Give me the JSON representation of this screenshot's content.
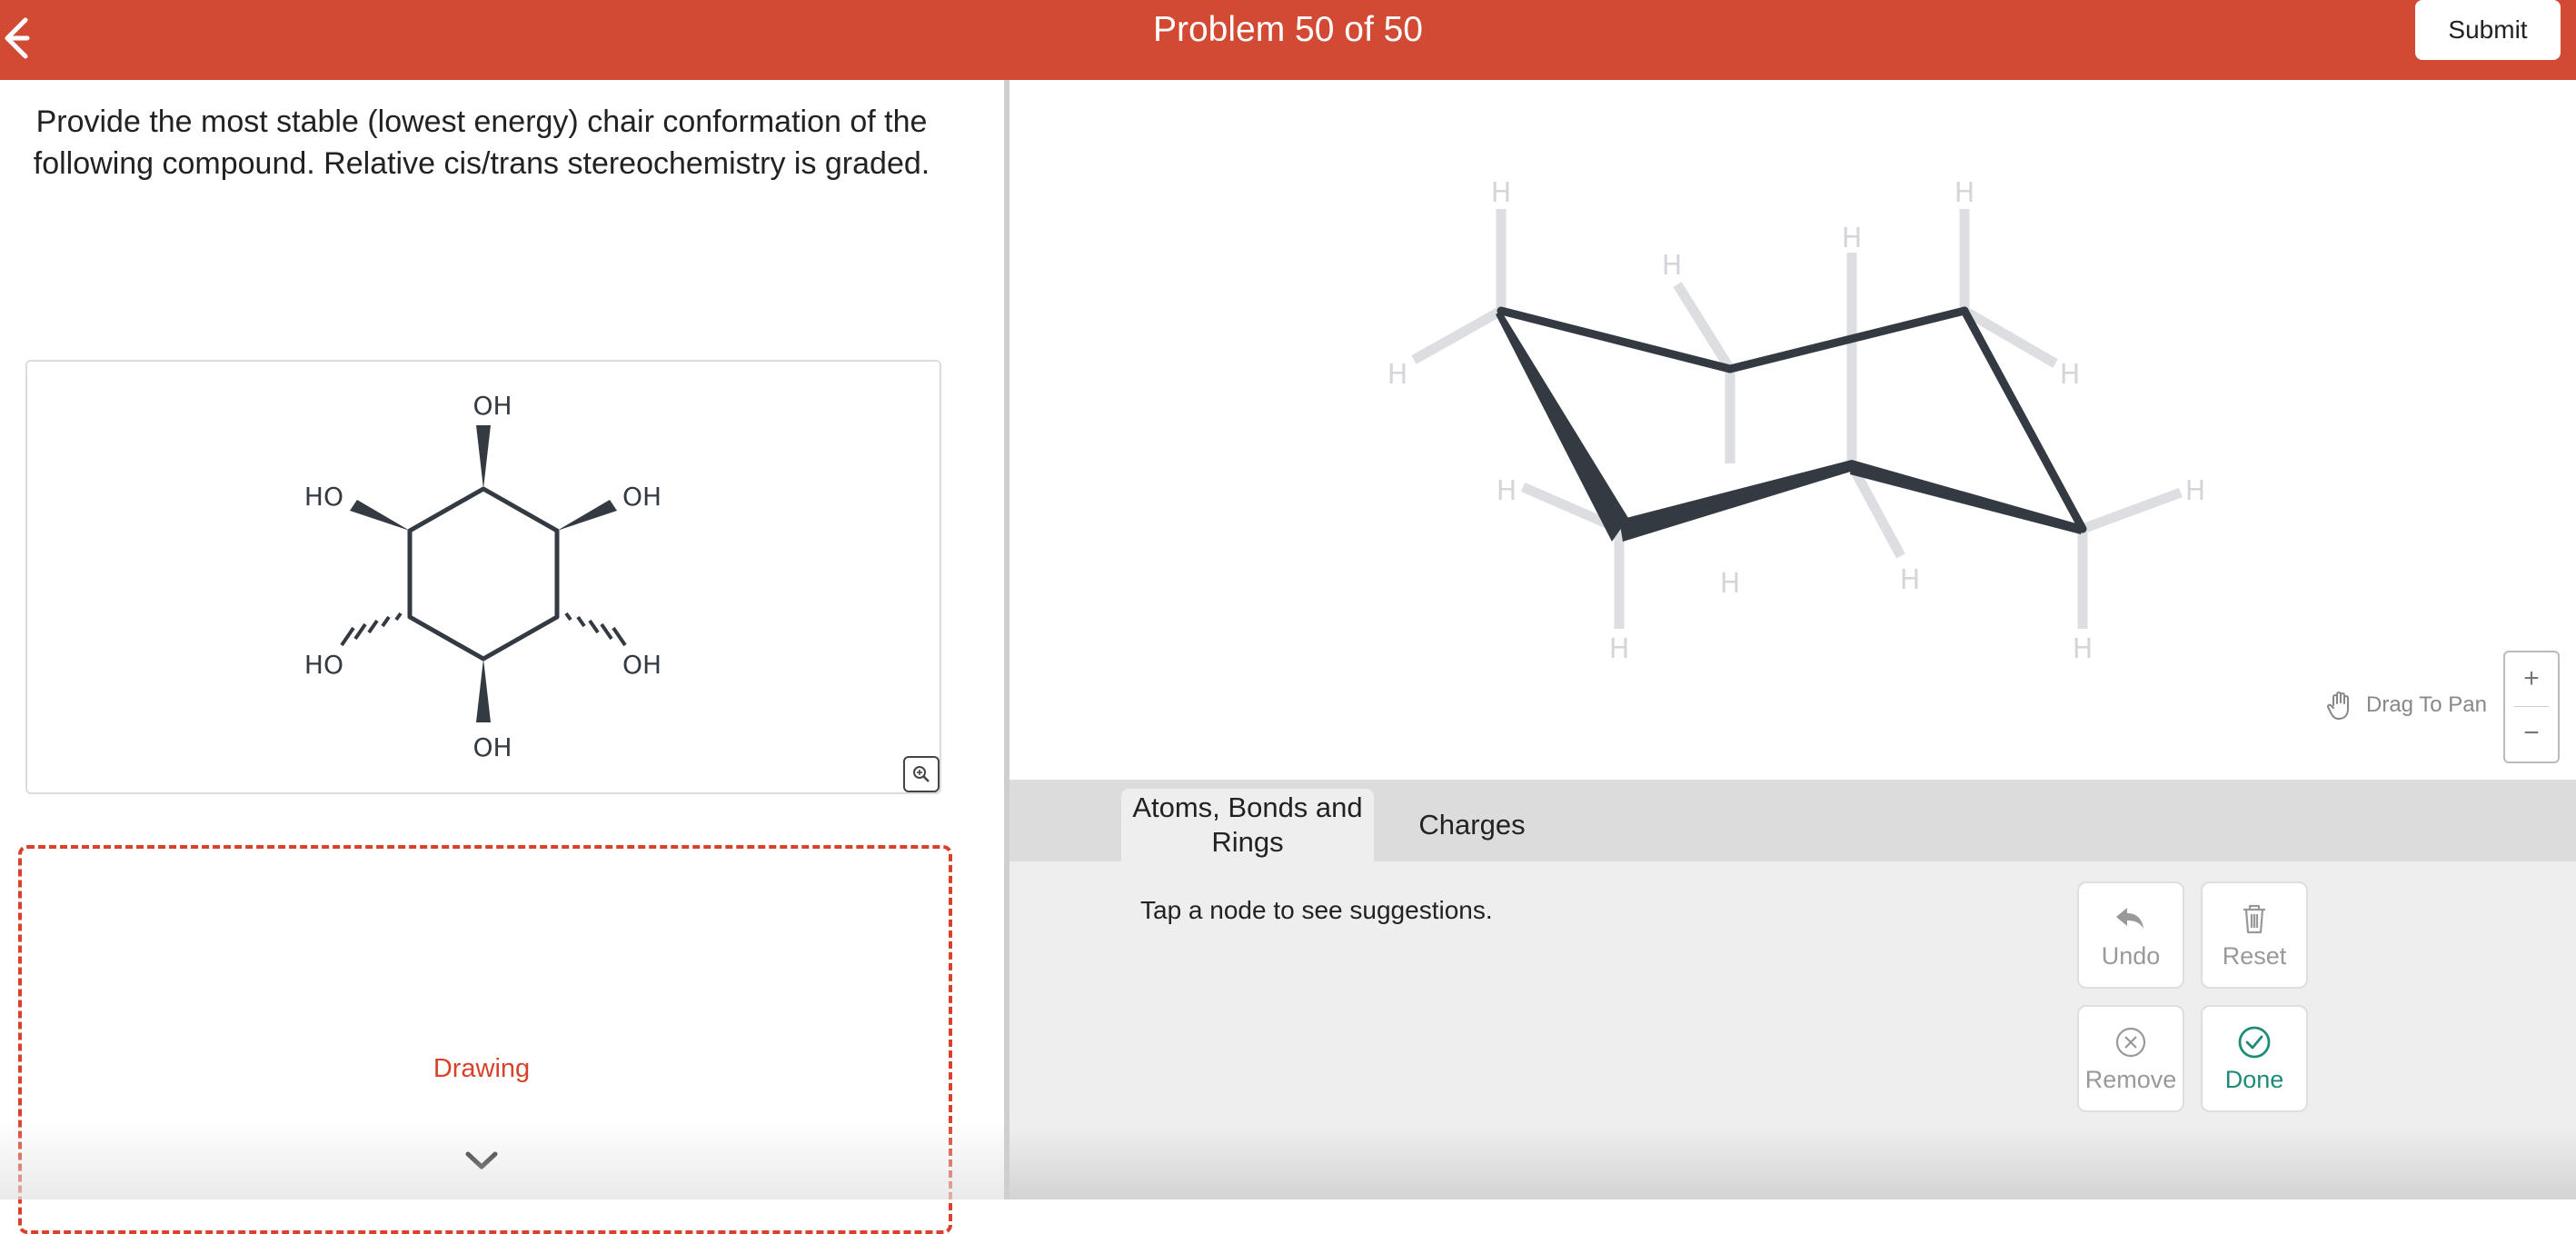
{
  "header": {
    "title": "Problem 50 of 50",
    "submit_label": "Submit",
    "back_icon": "arrow-left-icon",
    "colors": {
      "bar": "#d24a34",
      "text": "#ffffff"
    }
  },
  "question": {
    "text": "Provide the most stable (lowest energy) chair conformation of the following compound. Relative cis/trans stereochemistry is graded."
  },
  "molecule": {
    "labels": {
      "top": "OH",
      "upper_left": "HO",
      "upper_right": "OH",
      "lower_left": "HO",
      "lower_right": "OH",
      "bottom": "OH"
    },
    "zoom_icon": "zoom-in-icon"
  },
  "drawing": {
    "label": "Drawing",
    "chevron_icon": "chevron-down-icon",
    "border_color": "#d9412b"
  },
  "canvas": {
    "pan_hint": "Drag To Pan",
    "pan_icon": "hand-icon",
    "zoom_in": "+",
    "zoom_out": "−",
    "h_label": "H"
  },
  "tabs": [
    {
      "label": "Atoms, Bonds and Rings",
      "active": true
    },
    {
      "label": "Charges",
      "active": false
    }
  ],
  "tools": {
    "hint": "Tap a node to see suggestions.",
    "undo": "Undo",
    "reset": "Reset",
    "remove": "Remove",
    "done": "Done",
    "done_color": "#1f8a78"
  }
}
